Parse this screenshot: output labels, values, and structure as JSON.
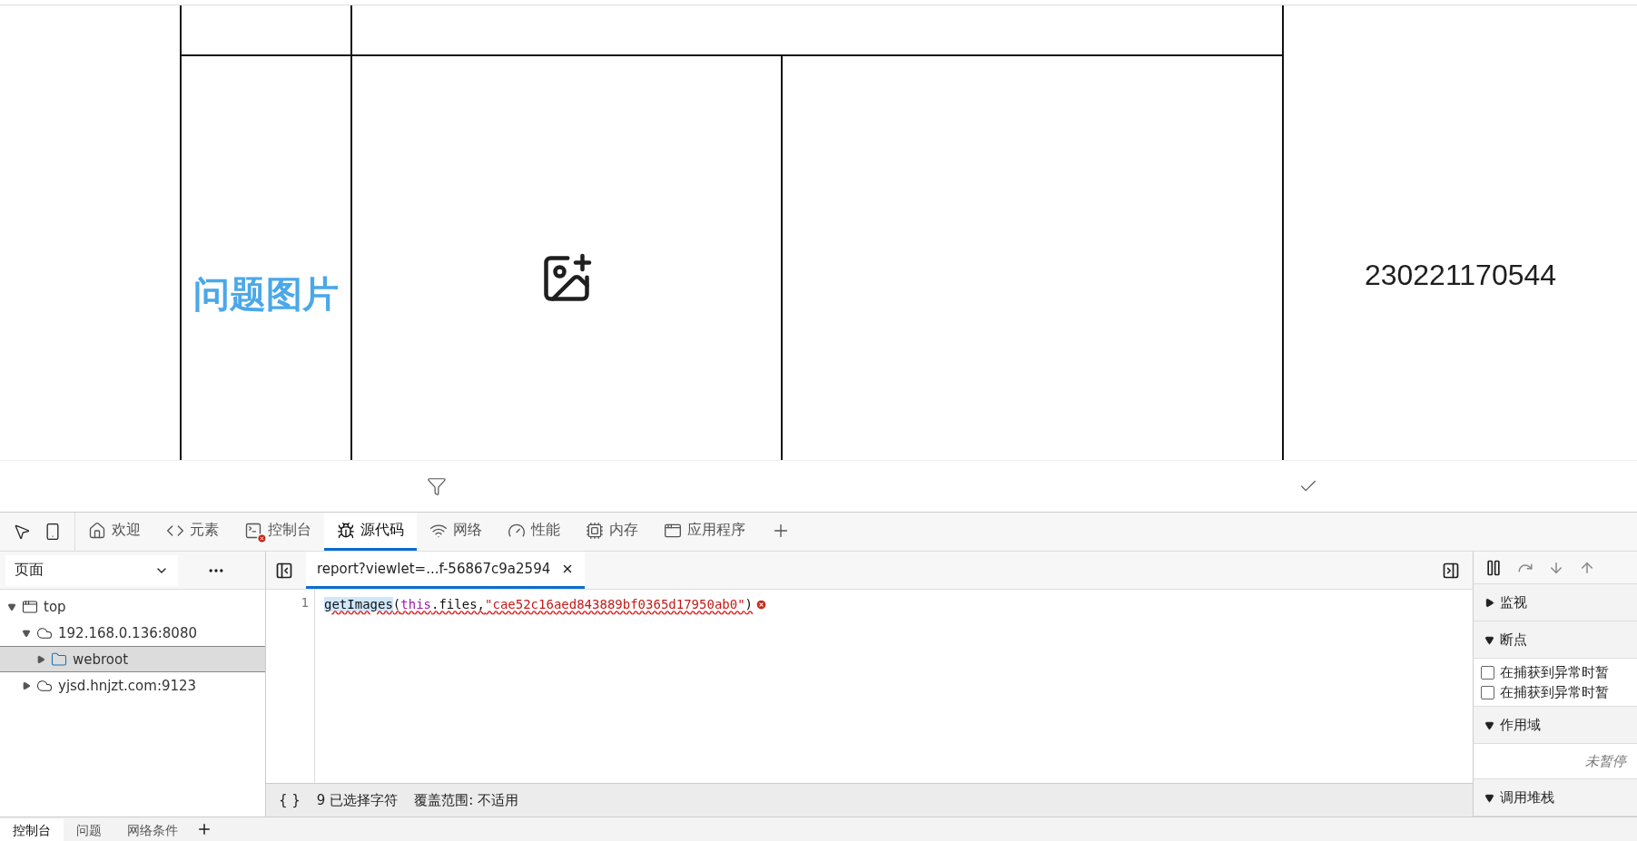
{
  "report": {
    "label": "问题图片",
    "number": "230221170544"
  },
  "devtools": {
    "tabs": [
      {
        "label": "欢迎",
        "error": false,
        "selected": false
      },
      {
        "label": "元素",
        "error": false,
        "selected": false
      },
      {
        "label": "控制台",
        "error": true,
        "selected": false
      },
      {
        "label": "源代码",
        "error": false,
        "selected": true
      },
      {
        "label": "网络",
        "error": false,
        "selected": false
      },
      {
        "label": "性能",
        "error": false,
        "selected": false
      },
      {
        "label": "内存",
        "error": false,
        "selected": false
      },
      {
        "label": "应用程序",
        "error": false,
        "selected": false
      }
    ]
  },
  "sources": {
    "navigator_tab": "页面",
    "tree": [
      {
        "label": "top",
        "kind": "frame",
        "expanded": true,
        "selected": false,
        "children": [
          {
            "label": "192.168.0.136:8080",
            "kind": "host",
            "expanded": true,
            "selected": false,
            "children": [
              {
                "label": "webroot",
                "kind": "folder",
                "expanded": false,
                "selected": true
              }
            ]
          },
          {
            "label": "yjsd.hnjzt.com:9123",
            "kind": "host",
            "expanded": false,
            "selected": false
          }
        ]
      }
    ],
    "file_tab": {
      "label": "report?viewlet=...f-56867c9a2594",
      "selected": true
    },
    "code_lines": [
      {
        "number": "1",
        "error": true,
        "tokens": [
          {
            "text": "getImages",
            "kind": "selected"
          },
          {
            "text": "(",
            "kind": "plain"
          },
          {
            "text": "this",
            "kind": "keyword"
          },
          {
            "text": ".files,",
            "kind": "plain"
          },
          {
            "text": "\"cae52c16aed843889bf0365d17950ab0\"",
            "kind": "string"
          },
          {
            "text": ")",
            "kind": "plain"
          }
        ]
      }
    ],
    "format_button": "{ }",
    "selection": "9 已选择字符",
    "coverage": "覆盖范围: 不适用"
  },
  "debugger": {
    "sections": [
      {
        "title": "监视",
        "expanded": false
      },
      {
        "title": "断点",
        "expanded": true,
        "checkboxes": [
          {
            "label": "在捕获到异常时暂",
            "checked": false
          },
          {
            "label": "在捕获到异常时暂",
            "checked": false
          }
        ]
      },
      {
        "title": "作用域",
        "expanded": true,
        "message": "未暂停"
      },
      {
        "title": "调用堆栈",
        "expanded": true
      }
    ]
  },
  "drawer_tabs": [
    {
      "label": "控制台",
      "selected": true
    },
    {
      "label": "问题",
      "selected": false
    },
    {
      "label": "网络条件",
      "selected": false
    }
  ]
}
